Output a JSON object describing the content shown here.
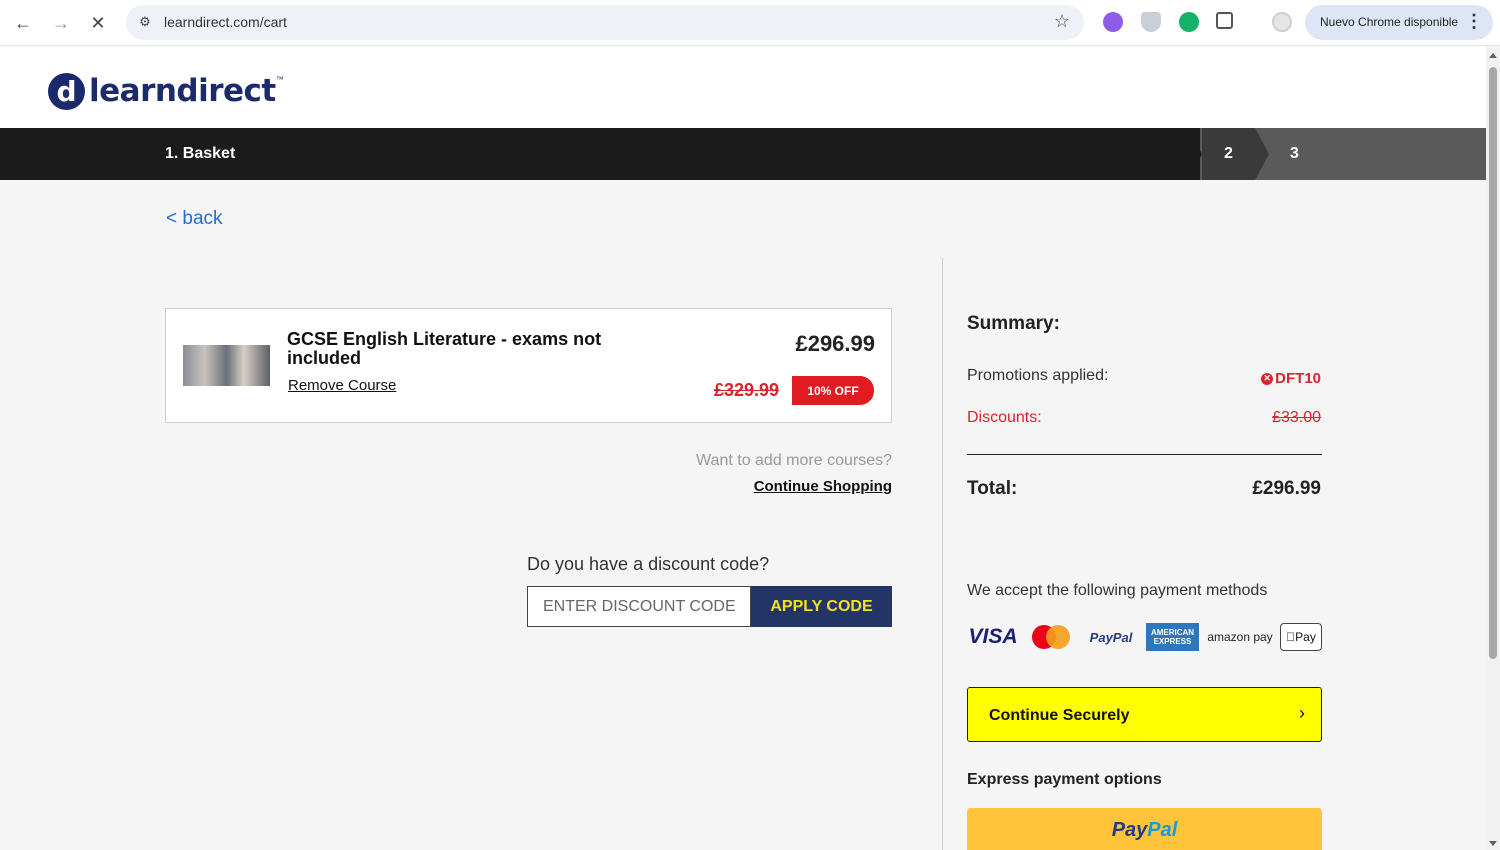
{
  "browser": {
    "url": "learndirect.com/cart",
    "chrome_update_label": "Nuevo Chrome disponible"
  },
  "site": {
    "logo_mark": "d",
    "logo_text": "learndirect",
    "logo_tm": "™"
  },
  "steps": {
    "step1_label": "1. Basket",
    "step2_label": "2",
    "step3_label": "3"
  },
  "nav": {
    "back_label": "< back"
  },
  "cart": {
    "course_title": "GCSE English Literature - exams not included",
    "remove_label": "Remove Course",
    "price": "£296.99",
    "old_price": "£329.99",
    "discount_badge": "10% OFF",
    "want_more": "Want to add more courses?",
    "continue_shopping": "Continue Shopping"
  },
  "discount": {
    "question": "Do you have a discount code?",
    "placeholder": "ENTER DISCOUNT CODE",
    "apply_label": "APPLY CODE"
  },
  "summary": {
    "title": "Summary:",
    "promotions_label": "Promotions applied:",
    "promotion_code": "DFT10",
    "discounts_label": "Discounts:",
    "discounts_value": "£33.00",
    "total_label": "Total:",
    "total_value": "£296.99"
  },
  "payment": {
    "accept_label": "We accept the following payment methods",
    "methods": {
      "visa": "VISA",
      "paypal": "PayPal",
      "amex": "AMERICAN EXPRESS",
      "amazon": "amazon pay",
      "applepay": "Pay"
    },
    "continue_label": "Continue Securely",
    "express_label": "Express payment options",
    "paypal_pay": "Pay",
    "paypal_pal": "Pal"
  },
  "colors": {
    "brand_navy": "#1b2a6b",
    "promo_red": "#d9252d",
    "continue_yellow": "#ffff00",
    "apply_button": "#233567",
    "paypal_gold": "#ffc439"
  }
}
